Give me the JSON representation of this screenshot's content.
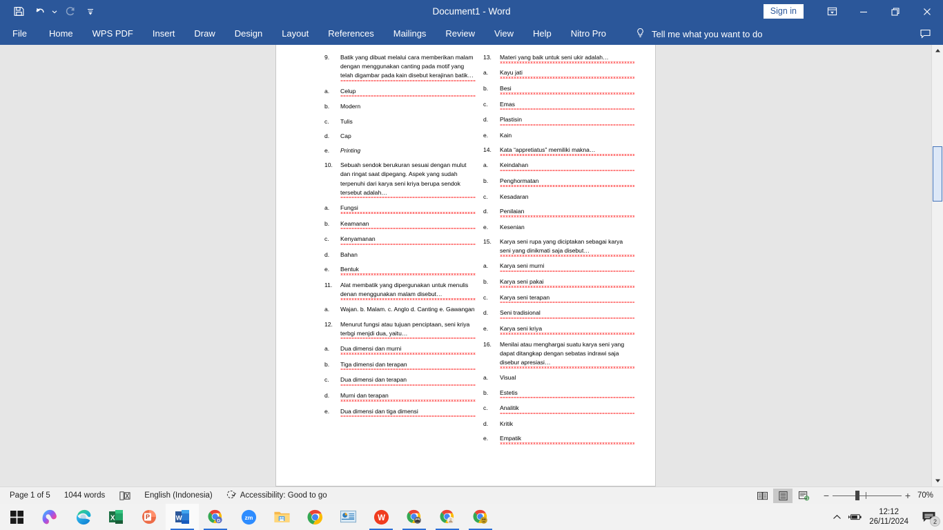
{
  "titlebar": {
    "title": "Document1  -  Word",
    "sign_in": "Sign in",
    "quick_access": [
      {
        "name": "save-icon",
        "label": "Save"
      },
      {
        "name": "undo-icon",
        "label": "Undo"
      },
      {
        "name": "undo-dropdown-icon",
        "label": "Undo options"
      },
      {
        "name": "redo-icon",
        "label": "Redo"
      },
      {
        "name": "customize-qat-icon",
        "label": "Customize Quick Access Toolbar"
      }
    ],
    "window_controls": [
      {
        "name": "ribbon-display-options-icon",
        "label": "Ribbon Display Options"
      },
      {
        "name": "minimize-icon",
        "label": "Minimize"
      },
      {
        "name": "restore-icon",
        "label": "Restore Down"
      },
      {
        "name": "close-icon",
        "label": "Close"
      }
    ]
  },
  "ribbon": {
    "tabs": [
      "File",
      "Home",
      "WPS PDF",
      "Insert",
      "Draw",
      "Design",
      "Layout",
      "References",
      "Mailings",
      "Review",
      "View",
      "Help",
      "Nitro Pro"
    ],
    "tell_me": "Tell me what you want to do",
    "comments_label": "Comments"
  },
  "document": {
    "left_column": [
      {
        "number": "9.",
        "question": "Batik yang dibuat melalui cara memberikan malam dengan menggunakan canting pada motif yang telah digambar pada kain disebut kerajinan batik…",
        "options": [
          {
            "marker": "a.",
            "text": "Celup",
            "italic": false
          },
          {
            "marker": "b.",
            "text": "Modern",
            "italic": false
          },
          {
            "marker": "c.",
            "text": "Tulis",
            "italic": false
          },
          {
            "marker": "d.",
            "text": "Cap",
            "italic": false
          },
          {
            "marker": "e.",
            "text": "Printing",
            "italic": true
          }
        ]
      },
      {
        "number": "10.",
        "question": "Sebuah sendok berukuran sesuai dengan mulut dan ringat saat dipegang. Aspek yang sudah terpenuhi dari karya seni kriya berupa sendok tersebut adalah…",
        "options": [
          {
            "marker": "a.",
            "text": "Fungsi",
            "italic": false
          },
          {
            "marker": "b.",
            "text": "Keamanan",
            "italic": false
          },
          {
            "marker": "c.",
            "text": "Kenyamanan",
            "italic": false
          },
          {
            "marker": "d.",
            "text": "Bahan",
            "italic": false
          },
          {
            "marker": "e.",
            "text": "Bentuk",
            "italic": false
          }
        ]
      },
      {
        "number": "11.",
        "question": "Alat membatik yang dipergunakan untuk menulis denan menggunakan malam disebut…",
        "options": [
          {
            "marker": "a.",
            "text": "Wajan. b. Malam. c. Anglo d. Canting e. Gawangan",
            "italic": false
          }
        ]
      },
      {
        "number": "12.",
        "question": "Menurut fungsi atau tujuan penciptaan, seni kriya terbgi menjdi dua, yaitu…",
        "options": [
          {
            "marker": "a.",
            "text": "Dua dimensi dan murni",
            "italic": false
          },
          {
            "marker": "b.",
            "text": "Tiga dimensi dan terapan",
            "italic": false
          },
          {
            "marker": "c.",
            "text": "Dua dimensi dan terapan",
            "italic": false
          },
          {
            "marker": "d.",
            "text": "Murni dan terapan",
            "italic": false
          },
          {
            "marker": "e.",
            "text": "Dua dimensi dan tiga dimensi",
            "italic": false
          }
        ]
      }
    ],
    "right_column": [
      {
        "number": "13.",
        "question": "Materi yang baik untuk seni ukir adalah…",
        "options": [
          {
            "marker": "a.",
            "text": "Kayu jati",
            "italic": false
          },
          {
            "marker": "b.",
            "text": "Besi",
            "italic": false
          },
          {
            "marker": "c.",
            "text": "Emas",
            "italic": false
          },
          {
            "marker": "d.",
            "text": "Plastisin",
            "italic": false
          },
          {
            "marker": "e.",
            "text": "Kain",
            "italic": false
          }
        ]
      },
      {
        "number": "14.",
        "question": "Kata “appretiatus” memiliki makna…",
        "options": [
          {
            "marker": "a.",
            "text": "Keindahan",
            "italic": false
          },
          {
            "marker": "b.",
            "text": "Penghormatan",
            "italic": false
          },
          {
            "marker": "c.",
            "text": "Kesadaran",
            "italic": false
          },
          {
            "marker": "d.",
            "text": "Penilaian",
            "italic": false
          },
          {
            "marker": "e.",
            "text": "Kesenian",
            "italic": false
          }
        ]
      },
      {
        "number": "15.",
        "question": "Karya seni rupa yang diciptakan sebagai karya seni yang dinikmati saja disebut…",
        "options": [
          {
            "marker": "a.",
            "text": "Karya seni murni",
            "italic": false
          },
          {
            "marker": "b.",
            "text": "Karya seni pakai",
            "italic": false
          },
          {
            "marker": "c.",
            "text": "Karya seni terapan",
            "italic": false
          },
          {
            "marker": "d.",
            "text": "Seni tradisional",
            "italic": false
          },
          {
            "marker": "e.",
            "text": "Karya seni kriya",
            "italic": false
          }
        ]
      },
      {
        "number": "16.",
        "question": "Menilai atau menghargai suatu karya seni yang dapat ditangkap dengan sebatas indrawi saja disebur apresiasi…",
        "options": [
          {
            "marker": "a.",
            "text": "Visual",
            "italic": false
          },
          {
            "marker": "b.",
            "text": "Estetis",
            "italic": false
          },
          {
            "marker": "c.",
            "text": "Analitik",
            "italic": false
          },
          {
            "marker": "d.",
            "text": "Kritik",
            "italic": false
          },
          {
            "marker": "e.",
            "text": "Empatik",
            "italic": false
          }
        ]
      }
    ]
  },
  "statusbar": {
    "page": "Page 1 of 5",
    "words": "1044 words",
    "proofing_icon": "proofing-errors-icon",
    "language": "English (Indonesia)",
    "accessibility": "Accessibility: Good to go",
    "views": [
      {
        "name": "read-mode-icon",
        "label": "Read Mode",
        "active": false
      },
      {
        "name": "print-layout-icon",
        "label": "Print Layout",
        "active": true
      },
      {
        "name": "web-layout-icon",
        "label": "Web Layout",
        "active": false
      }
    ],
    "zoom": "70%",
    "zoom_out_label": "−",
    "zoom_in_label": "+"
  },
  "taskbar": {
    "items": [
      {
        "name": "start-button",
        "label": "Start",
        "active": false,
        "running": false
      },
      {
        "name": "copilot-icon",
        "label": "Copilot",
        "active": false,
        "running": false
      },
      {
        "name": "microsoft-edge-icon",
        "label": "Microsoft Edge",
        "active": false,
        "running": false
      },
      {
        "name": "excel-icon",
        "label": "Microsoft Excel",
        "active": false,
        "running": false
      },
      {
        "name": "powerpoint-icon",
        "label": "Microsoft PowerPoint",
        "active": false,
        "running": true
      },
      {
        "name": "word-icon",
        "label": "Microsoft Word",
        "active": true,
        "running": true
      },
      {
        "name": "chrome-docs-icon",
        "label": "Google Docs",
        "active": false,
        "running": true
      },
      {
        "name": "zoom-icon",
        "label": "Zoom",
        "active": false,
        "running": false
      },
      {
        "name": "file-explorer-icon",
        "label": "File Explorer",
        "active": false,
        "running": false
      },
      {
        "name": "google-chrome-icon",
        "label": "Google Chrome",
        "active": false,
        "running": false
      },
      {
        "name": "presentation-icon",
        "label": "Presentation",
        "active": false,
        "running": false
      },
      {
        "name": "wps-office-icon",
        "label": "WPS Office",
        "active": false,
        "running": true
      },
      {
        "name": "chrome-profile-1-icon",
        "label": "Chrome window",
        "active": false,
        "running": true
      },
      {
        "name": "chrome-profile-2-icon",
        "label": "Chrome window",
        "active": false,
        "running": true
      },
      {
        "name": "chrome-profile-3-icon",
        "label": "Chrome window",
        "active": false,
        "running": true
      }
    ],
    "tray": {
      "show_hidden_icon": "chevron-up-icon",
      "battery_icon": "battery-charging-icon",
      "time": "12:12",
      "date": "26/11/2024",
      "notification_icon": "notifications-icon",
      "notification_count": "2"
    }
  }
}
